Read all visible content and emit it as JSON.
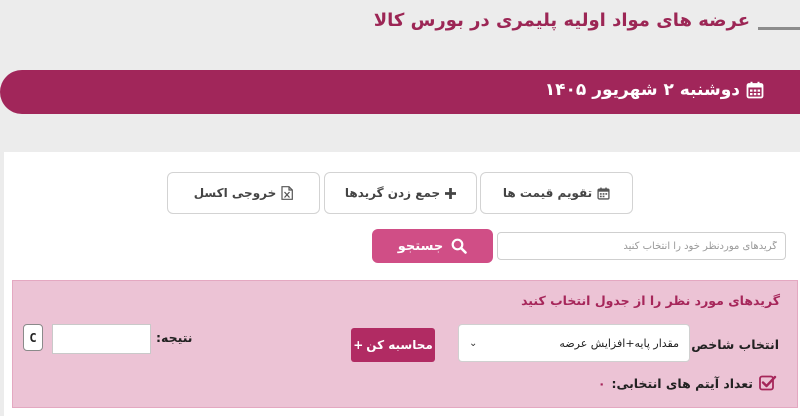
{
  "page": {
    "title": "عرضه های مواد اولیه پلیمری در بورس کالا",
    "date": "دوشنبه ۲ شهریور ۱۴۰۵"
  },
  "toolbar": {
    "price_calendar_label": "تقویم قیمت ها",
    "sum_grades_label": "جمع زدن گریدها",
    "excel_export_label": "خروجی اکسل"
  },
  "search": {
    "placeholder": "گریدهای موردنظر خود را انتخاب کنید",
    "value": "",
    "button_label": "جستجو"
  },
  "calculator": {
    "header": "گریدهای مورد نظر را از جدول انتخاب کنید",
    "index_label": "انتخاب شاخص",
    "index_selected": "مقدار پایه+افزایش عرضه",
    "calc_button_label": "محاسبه کن",
    "calc_button_prefix": "+",
    "result_label": "نتیجه:",
    "result_value": "",
    "clear_label": "C",
    "selected_count_label": "تعداد آیتم های انتخابی:",
    "selected_count_value": "۰"
  },
  "colors": {
    "brand": "#a1265a",
    "search_button": "#d04e86",
    "calc_box": "#ecc3d5"
  },
  "icons": {
    "date": "calendar-icon",
    "price_calendar": "calendar-icon",
    "sum": "plus-icon",
    "excel": "excel-file-icon",
    "search": "search-icon",
    "select": "chevron-down-icon",
    "count": "checkbox-checked-icon"
  }
}
